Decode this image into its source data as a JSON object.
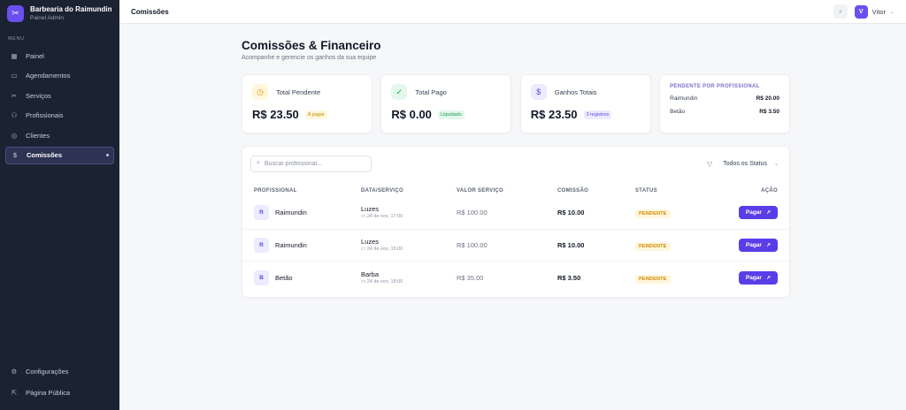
{
  "brand": {
    "name": "Barbearia do Raimundin",
    "subtitle": "Painel Admin"
  },
  "sidebar": {
    "menu_label": "MENU",
    "items": [
      {
        "label": "Painel",
        "icon": "grid-icon"
      },
      {
        "label": "Agendamentos",
        "icon": "calendar-icon"
      },
      {
        "label": "Serviços",
        "icon": "scissors-icon"
      },
      {
        "label": "Profissionais",
        "icon": "users-icon"
      },
      {
        "label": "Clientes",
        "icon": "user-circle-icon"
      },
      {
        "label": "Comissões",
        "icon": "dollar-icon",
        "active": true
      }
    ],
    "bottom": [
      {
        "label": "Configurações",
        "icon": "gear-icon"
      },
      {
        "label": "Página Pública",
        "icon": "external-link-icon"
      }
    ]
  },
  "topbar": {
    "title": "Comissões",
    "user_initial": "V",
    "user_name": "Vitor"
  },
  "page": {
    "title": "Comissões & Financeiro",
    "subtitle": "Acompanhe e gerencie os ganhos da sua equipe"
  },
  "cards": {
    "pending": {
      "label": "Total Pendente",
      "value": "R$ 23.50",
      "chip": "A pagar"
    },
    "paid": {
      "label": "Total Pago",
      "value": "R$ 0.00",
      "chip": "Liquidado"
    },
    "total": {
      "label": "Ganhos Totais",
      "value": "R$ 23.50",
      "chip": "3 registros"
    },
    "by_professional": {
      "title": "PENDENTE POR PROFISSIONAL",
      "rows": [
        {
          "name": "Raimundin",
          "value": "R$ 20.00"
        },
        {
          "name": "Betão",
          "value": "R$ 3.50"
        }
      ]
    }
  },
  "table": {
    "search_placeholder": "Buscar profissional...",
    "filter_value": "Todos os Status",
    "headers": [
      "PROFISSIONAL",
      "DATA/SERVIÇO",
      "VALOR SERVIÇO",
      "COMISSÃO",
      "STATUS",
      "AÇÃO"
    ],
    "rows": [
      {
        "initial": "R",
        "name": "Raimundin",
        "service": "Luzes",
        "date": "24 de nov, 17:00",
        "service_value": "R$ 100.00",
        "commission": "R$ 10.00",
        "status": "PENDENTE",
        "action": "Pagar"
      },
      {
        "initial": "R",
        "name": "Raimundin",
        "service": "Luzes",
        "date": "24 de nov, 15:00",
        "service_value": "R$ 100.00",
        "commission": "R$ 10.00",
        "status": "PENDENTE",
        "action": "Pagar"
      },
      {
        "initial": "B",
        "name": "Betão",
        "service": "Barba",
        "date": "24 de nov, 18:00",
        "service_value": "R$ 35.00",
        "commission": "R$ 3.50",
        "status": "PENDENTE",
        "action": "Pagar"
      }
    ]
  },
  "colors": {
    "accent": "#5b3de8",
    "sidebar_bg": "#1b2232",
    "pending": "#d08a00",
    "paid": "#16a34a"
  }
}
